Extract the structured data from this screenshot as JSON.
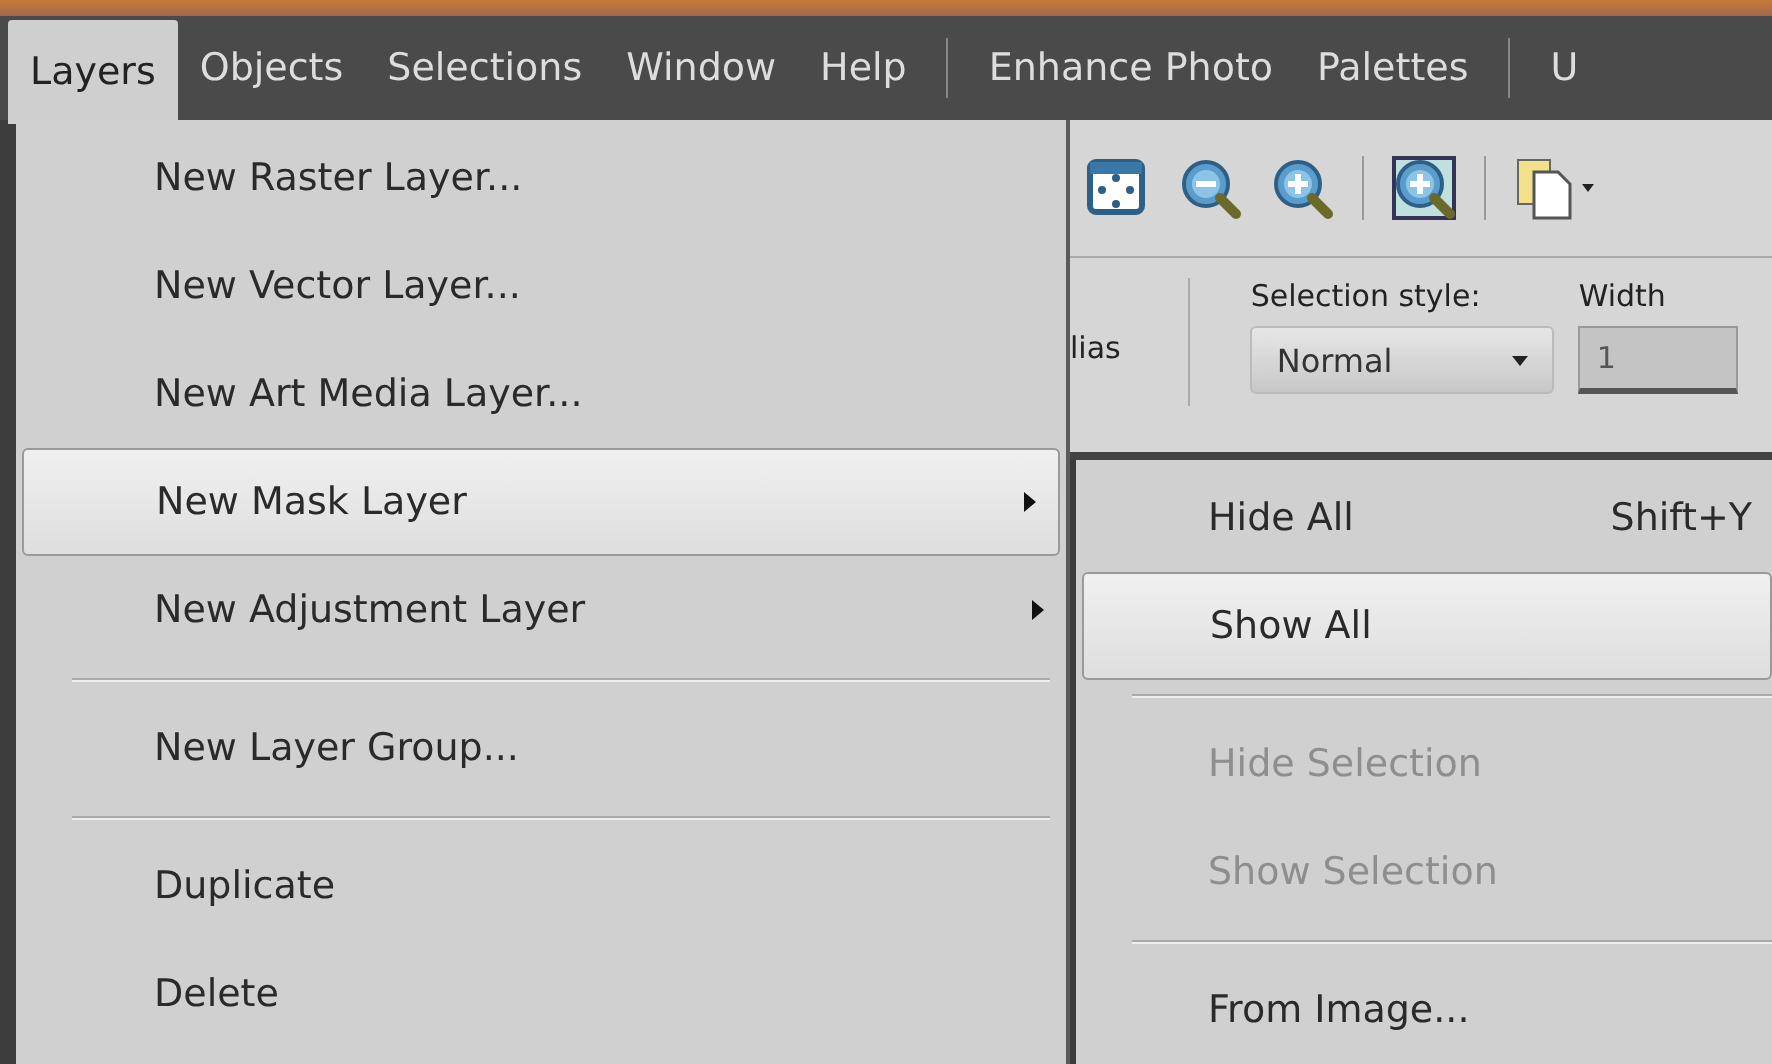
{
  "menu_bar": [
    {
      "kind": "item",
      "label": "Layers",
      "selected": true
    },
    {
      "kind": "item",
      "label": "Objects",
      "selected": false
    },
    {
      "kind": "item",
      "label": "Selections",
      "selected": false
    },
    {
      "kind": "item",
      "label": "Window",
      "selected": false
    },
    {
      "kind": "item",
      "label": "Help",
      "selected": false
    },
    {
      "kind": "separator"
    },
    {
      "kind": "item",
      "label": "Enhance Photo",
      "selected": false
    },
    {
      "kind": "item",
      "label": "Palettes",
      "selected": false
    },
    {
      "kind": "separator"
    },
    {
      "kind": "item",
      "label": "U",
      "selected": false
    }
  ],
  "layers_menu": [
    {
      "kind": "item",
      "label": "New Raster Layer...",
      "selected": false,
      "has_submenu": false
    },
    {
      "kind": "item",
      "label": "New Vector Layer...",
      "selected": false,
      "has_submenu": false
    },
    {
      "kind": "item",
      "label": "New Art Media Layer...",
      "selected": false,
      "has_submenu": false
    },
    {
      "kind": "item",
      "label": "New Mask Layer",
      "selected": true,
      "has_submenu": true
    },
    {
      "kind": "item",
      "label": "New Adjustment Layer",
      "selected": false,
      "has_submenu": true
    },
    {
      "kind": "separator"
    },
    {
      "kind": "item",
      "label": "New Layer Group...",
      "selected": false,
      "has_submenu": false
    },
    {
      "kind": "separator"
    },
    {
      "kind": "item",
      "label": "Duplicate",
      "selected": false,
      "has_submenu": false
    },
    {
      "kind": "item",
      "label": "Delete",
      "selected": false,
      "has_submenu": false
    }
  ],
  "toolbar": {
    "tools": [
      {
        "kind": "fit"
      },
      {
        "kind": "zoom-out"
      },
      {
        "kind": "zoom-in"
      },
      {
        "kind": "separator"
      },
      {
        "kind": "zoom-box"
      },
      {
        "kind": "separator"
      },
      {
        "kind": "pages"
      }
    ]
  },
  "tool_options": {
    "partial_label": "lias",
    "selection_style": {
      "label": "Selection style:",
      "value": "Normal"
    },
    "width": {
      "label": "Width",
      "value": "1"
    }
  },
  "mask_submenu": [
    {
      "kind": "item",
      "label": "Hide All",
      "shortcut": "Shift+Y",
      "selected": false,
      "disabled": false
    },
    {
      "kind": "item",
      "label": "Show All",
      "selected": true,
      "disabled": false
    },
    {
      "kind": "separator"
    },
    {
      "kind": "item",
      "label": "Hide Selection",
      "selected": false,
      "disabled": true
    },
    {
      "kind": "item",
      "label": "Show Selection",
      "selected": false,
      "disabled": true
    },
    {
      "kind": "separator"
    },
    {
      "kind": "item",
      "label": "From Image...",
      "selected": false,
      "disabled": false
    }
  ]
}
